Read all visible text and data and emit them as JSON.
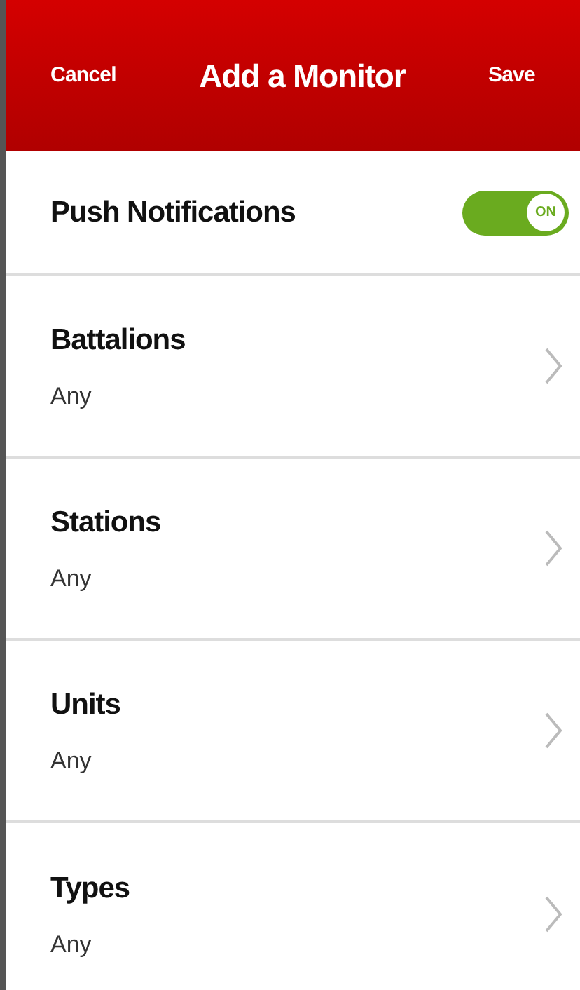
{
  "header": {
    "cancel": "Cancel",
    "title": "Add a Monitor",
    "save": "Save"
  },
  "push": {
    "label": "Push Notifications",
    "on": true,
    "toggle_text": "ON"
  },
  "filters": [
    {
      "title": "Battalions",
      "value": "Any"
    },
    {
      "title": "Stations",
      "value": "Any"
    },
    {
      "title": "Units",
      "value": "Any"
    },
    {
      "title": "Types",
      "value": "Any"
    }
  ]
}
